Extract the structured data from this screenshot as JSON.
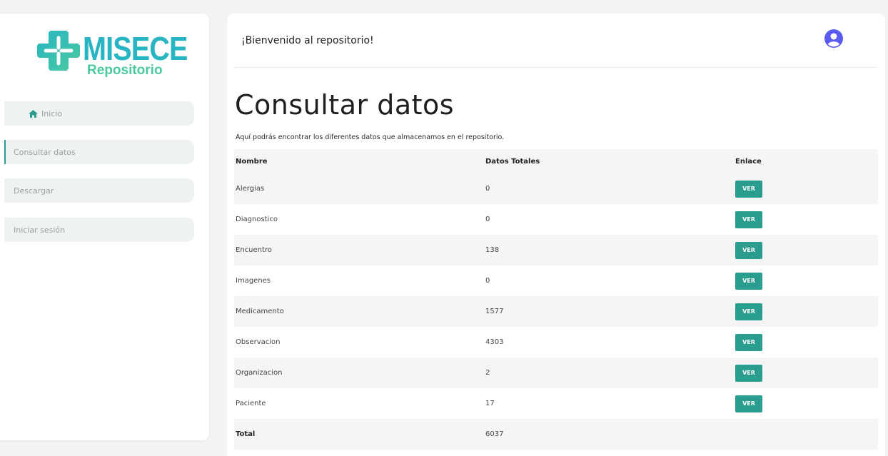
{
  "brand": {
    "name": "MISECE",
    "subtitle": "Repositorio",
    "primary_color": "#27b5c3",
    "secondary_color": "#4cc9a0"
  },
  "sidebar": {
    "items": [
      {
        "label": "Inicio",
        "icon": "home-icon",
        "active": false
      },
      {
        "label": "Consultar datos",
        "active": true
      },
      {
        "label": "Descargar",
        "active": false
      },
      {
        "label": "Iniciar sesión",
        "active": false
      }
    ]
  },
  "header": {
    "welcome": "¡Bienvenido al repositorio!",
    "user_icon": "user-circle-icon"
  },
  "main": {
    "title": "Consultar datos",
    "description": "Aquí podrás encontrar los diferentes datos que almacenamos en el repositorio.",
    "accent_color": "#2a9d8f"
  },
  "table": {
    "headers": {
      "name": "Nombre",
      "total": "Datos Totales",
      "link": "Enlace"
    },
    "rows": [
      {
        "name": "Alergias",
        "total": "0",
        "link": "VER"
      },
      {
        "name": "Diagnostico",
        "total": "0",
        "link": "VER"
      },
      {
        "name": "Encuentro",
        "total": "138",
        "link": "VER"
      },
      {
        "name": "Imagenes",
        "total": "0",
        "link": "VER"
      },
      {
        "name": "Medicamento",
        "total": "1577",
        "link": "VER"
      },
      {
        "name": "Observacion",
        "total": "4303",
        "link": "VER"
      },
      {
        "name": "Organizacion",
        "total": "2",
        "link": "VER"
      },
      {
        "name": "Paciente",
        "total": "17",
        "link": "VER"
      }
    ],
    "total_label": "Total",
    "total_value": "6037"
  }
}
